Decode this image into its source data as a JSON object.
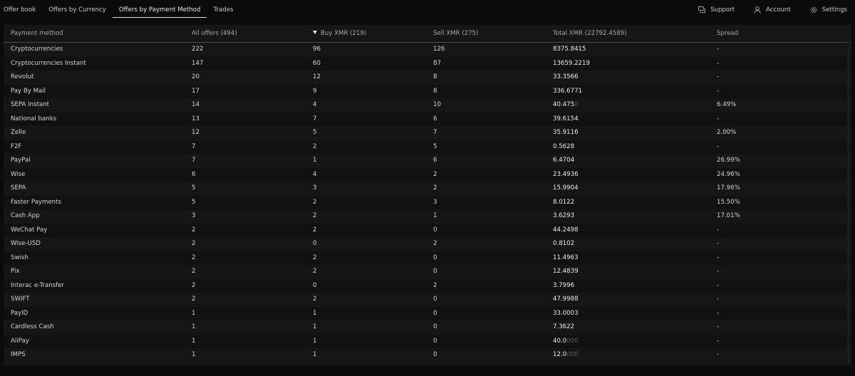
{
  "nav": {
    "tabs": [
      {
        "label": "Offer book"
      },
      {
        "label": "Offers by Currency"
      },
      {
        "label": "Offers by Payment Method"
      },
      {
        "label": "Trades"
      }
    ],
    "active_tab": "Offers by Payment Method",
    "actions": {
      "support": "Support",
      "account": "Account",
      "settings": "Settings"
    }
  },
  "table": {
    "headers": {
      "payment_method": "Payment method",
      "all_offers": "All offers (494)",
      "buy": "Buy XMR (219)",
      "sell": "Sell XMR (275)",
      "total": "Total XMR (22792.4589)",
      "spread": "Spread"
    },
    "sorted_column": "Buy XMR (219)",
    "rows": [
      {
        "method": "Cryptocurrencies",
        "all": "222",
        "buy": "96",
        "sell": "126",
        "total": "8375.8415",
        "total_dim": "",
        "spread": "-"
      },
      {
        "method": "Cryptocurrencies Instant",
        "all": "147",
        "buy": "60",
        "sell": "87",
        "total": "13659.2219",
        "total_dim": "",
        "spread": "-"
      },
      {
        "method": "Revolut",
        "all": "20",
        "buy": "12",
        "sell": "8",
        "total": "33.3566",
        "total_dim": "",
        "spread": "-"
      },
      {
        "method": "Pay By Mail",
        "all": "17",
        "buy": "9",
        "sell": "8",
        "total": "336.6771",
        "total_dim": "",
        "spread": "-"
      },
      {
        "method": "SEPA Instant",
        "all": "14",
        "buy": "4",
        "sell": "10",
        "total": "40.475",
        "total_dim": "0",
        "spread": "6.49%"
      },
      {
        "method": "National banks",
        "all": "13",
        "buy": "7",
        "sell": "6",
        "total": "39.6154",
        "total_dim": "",
        "spread": "-"
      },
      {
        "method": "Zelle",
        "all": "12",
        "buy": "5",
        "sell": "7",
        "total": "35.9116",
        "total_dim": "",
        "spread": "2.00%"
      },
      {
        "method": "F2F",
        "all": "7",
        "buy": "2",
        "sell": "5",
        "total": "0.5628",
        "total_dim": "",
        "spread": "-"
      },
      {
        "method": "PayPal",
        "all": "7",
        "buy": "1",
        "sell": "6",
        "total": "6.4704",
        "total_dim": "",
        "spread": "26.99%"
      },
      {
        "method": "Wise",
        "all": "6",
        "buy": "4",
        "sell": "2",
        "total": "23.4936",
        "total_dim": "",
        "spread": "24.96%"
      },
      {
        "method": "SEPA",
        "all": "5",
        "buy": "3",
        "sell": "2",
        "total": "15.9904",
        "total_dim": "",
        "spread": "17.96%"
      },
      {
        "method": "Faster Payments",
        "all": "5",
        "buy": "2",
        "sell": "3",
        "total": "8.0122",
        "total_dim": "",
        "spread": "15.50%"
      },
      {
        "method": "Cash App",
        "all": "3",
        "buy": "2",
        "sell": "1",
        "total": "3.6293",
        "total_dim": "",
        "spread": "17.01%"
      },
      {
        "method": "WeChat Pay",
        "all": "2",
        "buy": "2",
        "sell": "0",
        "total": "44.2498",
        "total_dim": "",
        "spread": "-"
      },
      {
        "method": "Wise-USD",
        "all": "2",
        "buy": "0",
        "sell": "2",
        "total": "0.8102",
        "total_dim": "",
        "spread": "-"
      },
      {
        "method": "Swish",
        "all": "2",
        "buy": "2",
        "sell": "0",
        "total": "11.4963",
        "total_dim": "",
        "spread": "-"
      },
      {
        "method": "Pix",
        "all": "2",
        "buy": "2",
        "sell": "0",
        "total": "12.4839",
        "total_dim": "",
        "spread": "-"
      },
      {
        "method": "Interac e-Transfer",
        "all": "2",
        "buy": "0",
        "sell": "2",
        "total": "3.7996",
        "total_dim": "",
        "spread": "-"
      },
      {
        "method": "SWIFT",
        "all": "2",
        "buy": "2",
        "sell": "0",
        "total": "47.9988",
        "total_dim": "",
        "spread": "-"
      },
      {
        "method": "PayID",
        "all": "1",
        "buy": "1",
        "sell": "0",
        "total": "33.0003",
        "total_dim": "",
        "spread": "-"
      },
      {
        "method": "Cardless Cash",
        "all": "1",
        "buy": "1",
        "sell": "0",
        "total": "7.3622",
        "total_dim": "",
        "spread": "-"
      },
      {
        "method": "AliPay",
        "all": "1",
        "buy": "1",
        "sell": "0",
        "total": "40.0",
        "total_dim": "000",
        "spread": "-"
      },
      {
        "method": "IMPS",
        "all": "1",
        "buy": "1",
        "sell": "0",
        "total": "12.0",
        "total_dim": "000",
        "spread": "-"
      }
    ]
  }
}
